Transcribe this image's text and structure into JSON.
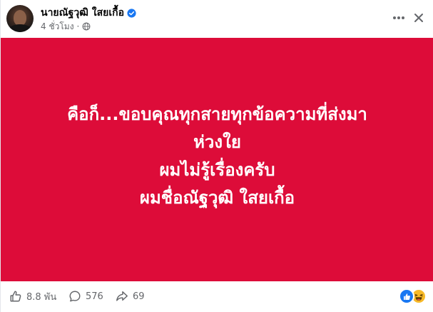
{
  "post": {
    "author_name": "นายณัฐวุฒิ ใสยเกื้อ",
    "time_ago": "4 ชั่วโมง",
    "privacy_icon": "globe-icon",
    "verified_icon": "verified-badge-icon",
    "body": {
      "background_color": "#dd0c39",
      "text_color": "#ffffff",
      "lines": [
        "คือก็...ขอบคุณทุกสายทุกข้อความที่ส่งมา",
        "ห่วงใย",
        "ผมไม่รู้เรื่องครับ",
        "ผมชื่อณัฐวุฒิ ใสยเกื้อ"
      ]
    }
  },
  "footer": {
    "like_count": "8.8 พัน",
    "comment_count": "576",
    "share_count": "69",
    "reactions": [
      "like-reaction-icon",
      "haha-reaction-icon"
    ]
  },
  "colors": {
    "accent_blue": "#1877f2",
    "muted_text": "#65676b",
    "haha_yellow": "#f7b928"
  }
}
